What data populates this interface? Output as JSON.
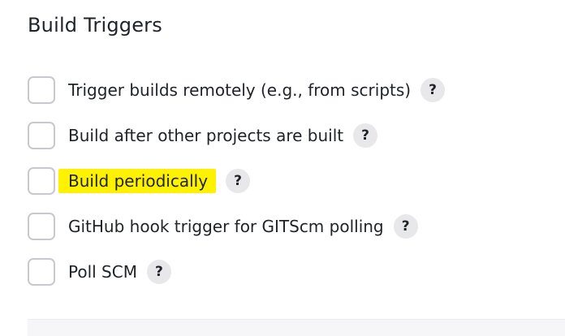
{
  "section": {
    "title": "Build Triggers"
  },
  "options": [
    {
      "label": "Trigger builds remotely (e.g., from scripts)",
      "checked": false,
      "help": "?"
    },
    {
      "label": "Build after other projects are built",
      "checked": false,
      "help": "?"
    },
    {
      "label": "Build periodically",
      "checked": false,
      "help": "?",
      "highlight_color": "#fff200"
    },
    {
      "label": "GitHub hook trigger for GITScm polling",
      "checked": false,
      "help": "?"
    },
    {
      "label": "Poll SCM",
      "checked": false,
      "help": "?"
    }
  ]
}
